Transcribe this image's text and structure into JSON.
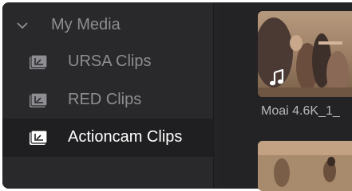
{
  "sidebar": {
    "root": {
      "label": "My Media",
      "icon": "chevron-down-icon"
    },
    "items": [
      {
        "label": "URSA Clips",
        "icon": "bin-icon",
        "selected": false
      },
      {
        "label": "RED Clips",
        "icon": "bin-icon",
        "selected": false
      },
      {
        "label": "Actioncam Clips",
        "icon": "bin-icon",
        "selected": true
      }
    ]
  },
  "media": {
    "clips": [
      {
        "name": "Moai 4.6K_1_",
        "badge_icon": "music-note-icon"
      },
      {
        "name": ""
      }
    ]
  },
  "colors": {
    "panel_bg": "#29292c",
    "selected_bg": "#1f1f21",
    "text_dim": "#8e8e92",
    "text_selected": "#ffffff"
  }
}
